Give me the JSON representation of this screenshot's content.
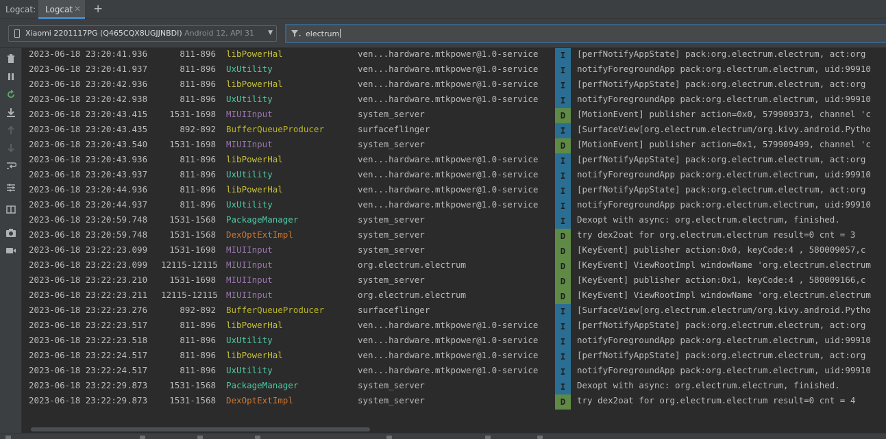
{
  "tabs": {
    "tool_window_title": "Logcat:",
    "active_tab": "Logcat",
    "close_glyph": "✕",
    "add_glyph": "+"
  },
  "device_selector": {
    "name": "Xiaomi 2201117PG (Q465CQX8UGJJNBDI)",
    "api": "Android 12, API 31"
  },
  "filter": {
    "query": "electrum",
    "icon": "filter-icon"
  },
  "sidebar": {
    "icons": [
      "trash-icon",
      "pause-icon",
      "restart-icon",
      "scroll-to-end-icon",
      "up-arrow-icon",
      "down-arrow-icon",
      "soft-wrap-icon",
      "settings-icon",
      "split-panels-icon",
      "camera-icon",
      "video-icon"
    ]
  },
  "colors": {
    "info_badge": "#2a6f93",
    "debug_badge": "#5f8a46",
    "tag_yellow": "#c7c13a",
    "tag_green": "#4ec9a4",
    "tag_purple": "#9876aa",
    "tag_orange": "#cc7832",
    "tag_olive": "#bbb529"
  },
  "log_rows": [
    {
      "ts": "2023-06-18 23:20:41.936",
      "pid": "811-896",
      "tag": "libPowerHal",
      "tag_color": "#c7c13a",
      "pkg": "ven...hardware.mtkpower@1.0-service",
      "level": "I",
      "msg": "[perfNotifyAppState] pack:org.electrum.electrum, act:org"
    },
    {
      "ts": "2023-06-18 23:20:41.937",
      "pid": "811-896",
      "tag": "UxUtility",
      "tag_color": "#4ec9a4",
      "pkg": "ven...hardware.mtkpower@1.0-service",
      "level": "I",
      "msg": "notifyForegroundApp pack:org.electrum.electrum, uid:99910"
    },
    {
      "ts": "2023-06-18 23:20:42.936",
      "pid": "811-896",
      "tag": "libPowerHal",
      "tag_color": "#c7c13a",
      "pkg": "ven...hardware.mtkpower@1.0-service",
      "level": "I",
      "msg": "[perfNotifyAppState] pack:org.electrum.electrum, act:org"
    },
    {
      "ts": "2023-06-18 23:20:42.938",
      "pid": "811-896",
      "tag": "UxUtility",
      "tag_color": "#4ec9a4",
      "pkg": "ven...hardware.mtkpower@1.0-service",
      "level": "I",
      "msg": "notifyForegroundApp pack:org.electrum.electrum, uid:99910"
    },
    {
      "ts": "2023-06-18 23:20:43.415",
      "pid": "1531-1698",
      "tag": "MIUIInput",
      "tag_color": "#9876aa",
      "pkg": "system_server",
      "level": "D",
      "msg": "[MotionEvent] publisher action=0x0, 579909373, channel 'c"
    },
    {
      "ts": "2023-06-18 23:20:43.435",
      "pid": "892-892",
      "tag": "BufferQueueProducer",
      "tag_color": "#bbb529",
      "pkg": "surfaceflinger",
      "level": "I",
      "msg": "[SurfaceView[org.electrum.electrum/org.kivy.android.Pytho"
    },
    {
      "ts": "2023-06-18 23:20:43.540",
      "pid": "1531-1698",
      "tag": "MIUIInput",
      "tag_color": "#9876aa",
      "pkg": "system_server",
      "level": "D",
      "msg": "[MotionEvent] publisher action=0x1, 579909499, channel 'c"
    },
    {
      "ts": "2023-06-18 23:20:43.936",
      "pid": "811-896",
      "tag": "libPowerHal",
      "tag_color": "#c7c13a",
      "pkg": "ven...hardware.mtkpower@1.0-service",
      "level": "I",
      "msg": "[perfNotifyAppState] pack:org.electrum.electrum, act:org"
    },
    {
      "ts": "2023-06-18 23:20:43.937",
      "pid": "811-896",
      "tag": "UxUtility",
      "tag_color": "#4ec9a4",
      "pkg": "ven...hardware.mtkpower@1.0-service",
      "level": "I",
      "msg": "notifyForegroundApp pack:org.electrum.electrum, uid:99910"
    },
    {
      "ts": "2023-06-18 23:20:44.936",
      "pid": "811-896",
      "tag": "libPowerHal",
      "tag_color": "#c7c13a",
      "pkg": "ven...hardware.mtkpower@1.0-service",
      "level": "I",
      "msg": "[perfNotifyAppState] pack:org.electrum.electrum, act:org"
    },
    {
      "ts": "2023-06-18 23:20:44.937",
      "pid": "811-896",
      "tag": "UxUtility",
      "tag_color": "#4ec9a4",
      "pkg": "ven...hardware.mtkpower@1.0-service",
      "level": "I",
      "msg": "notifyForegroundApp pack:org.electrum.electrum, uid:99910"
    },
    {
      "ts": "2023-06-18 23:20:59.748",
      "pid": "1531-1568",
      "tag": "PackageManager",
      "tag_color": "#4ec9a4",
      "pkg": "system_server",
      "level": "I",
      "msg": "Dexopt with async: org.electrum.electrum, finished."
    },
    {
      "ts": "2023-06-18 23:20:59.748",
      "pid": "1531-1568",
      "tag": "DexOptExtImpl",
      "tag_color": "#cc7832",
      "pkg": "system_server",
      "level": "D",
      "msg": "try dex2oat for org.electrum.electrum result=0 cnt = 3"
    },
    {
      "ts": "2023-06-18 23:22:23.099",
      "pid": "1531-1698",
      "tag": "MIUIInput",
      "tag_color": "#9876aa",
      "pkg": "system_server",
      "level": "D",
      "msg": "[KeyEvent] publisher action:0x0,  keyCode:4 , 580009057,c"
    },
    {
      "ts": "2023-06-18 23:22:23.099",
      "pid": "12115-12115",
      "tag": "MIUIInput",
      "tag_color": "#9876aa",
      "pkg": "org.electrum.electrum",
      "level": "D",
      "msg": "[KeyEvent] ViewRootImpl windowName 'org.electrum.electrum"
    },
    {
      "ts": "2023-06-18 23:22:23.210",
      "pid": "1531-1698",
      "tag": "MIUIInput",
      "tag_color": "#9876aa",
      "pkg": "system_server",
      "level": "D",
      "msg": "[KeyEvent] publisher action:0x1,  keyCode:4 , 580009166,c"
    },
    {
      "ts": "2023-06-18 23:22:23.211",
      "pid": "12115-12115",
      "tag": "MIUIInput",
      "tag_color": "#9876aa",
      "pkg": "org.electrum.electrum",
      "level": "D",
      "msg": "[KeyEvent] ViewRootImpl windowName 'org.electrum.electrum"
    },
    {
      "ts": "2023-06-18 23:22:23.276",
      "pid": "892-892",
      "tag": "BufferQueueProducer",
      "tag_color": "#bbb529",
      "pkg": "surfaceflinger",
      "level": "I",
      "msg": "[SurfaceView[org.electrum.electrum/org.kivy.android.Pytho"
    },
    {
      "ts": "2023-06-18 23:22:23.517",
      "pid": "811-896",
      "tag": "libPowerHal",
      "tag_color": "#c7c13a",
      "pkg": "ven...hardware.mtkpower@1.0-service",
      "level": "I",
      "msg": "[perfNotifyAppState] pack:org.electrum.electrum, act:org"
    },
    {
      "ts": "2023-06-18 23:22:23.518",
      "pid": "811-896",
      "tag": "UxUtility",
      "tag_color": "#4ec9a4",
      "pkg": "ven...hardware.mtkpower@1.0-service",
      "level": "I",
      "msg": "notifyForegroundApp pack:org.electrum.electrum, uid:99910"
    },
    {
      "ts": "2023-06-18 23:22:24.517",
      "pid": "811-896",
      "tag": "libPowerHal",
      "tag_color": "#c7c13a",
      "pkg": "ven...hardware.mtkpower@1.0-service",
      "level": "I",
      "msg": "[perfNotifyAppState] pack:org.electrum.electrum, act:org"
    },
    {
      "ts": "2023-06-18 23:22:24.517",
      "pid": "811-896",
      "tag": "UxUtility",
      "tag_color": "#4ec9a4",
      "pkg": "ven...hardware.mtkpower@1.0-service",
      "level": "I",
      "msg": "notifyForegroundApp pack:org.electrum.electrum, uid:99910"
    },
    {
      "ts": "2023-06-18 23:22:29.873",
      "pid": "1531-1568",
      "tag": "PackageManager",
      "tag_color": "#4ec9a4",
      "pkg": "system_server",
      "level": "I",
      "msg": "Dexopt with async: org.electrum.electrum, finished."
    },
    {
      "ts": "2023-06-18 23:22:29.873",
      "pid": "1531-1568",
      "tag": "DexOptExtImpl",
      "tag_color": "#cc7832",
      "pkg": "system_server",
      "level": "D",
      "msg": "try dex2oat for org.electrum.electrum result=0 cnt = 4"
    }
  ]
}
